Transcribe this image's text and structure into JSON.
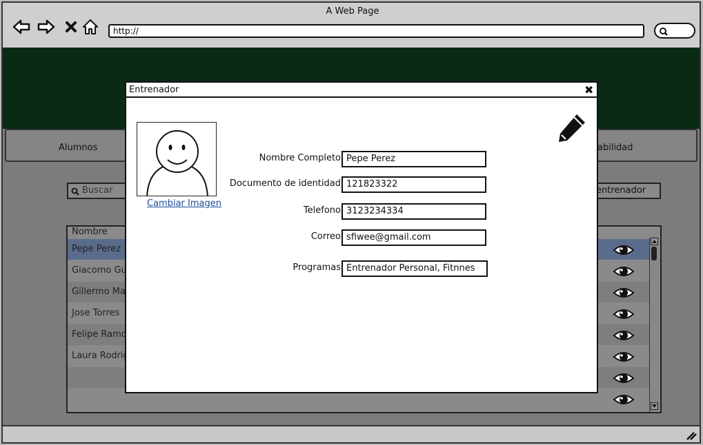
{
  "window": {
    "title": "A Web Page",
    "url": "http://"
  },
  "tabs": [
    {
      "label": "Alumnos"
    },
    {
      "label": "abilidad"
    }
  ],
  "toolbar": {
    "search_placeholder": "Buscar",
    "add_label": "entrenador"
  },
  "table": {
    "column_header": "Nombre",
    "rows": [
      {
        "name": "Pepe Perez",
        "selected": true
      },
      {
        "name": "Giacomo Guili"
      },
      {
        "name": "Gillermo Martı"
      },
      {
        "name": "Jose Torres"
      },
      {
        "name": "Felipe Ramos"
      },
      {
        "name": "Laura Rodrigu"
      },
      {
        "name": ""
      },
      {
        "name": ""
      }
    ]
  },
  "modal": {
    "title": "Entrenador",
    "close_symbol": "✖",
    "change_image_label": "Cambiar Imagen",
    "fields": [
      {
        "label": "Nombre Completo",
        "value": "Pepe Perez"
      },
      {
        "label": "Documento de identidad",
        "value": "121823322"
      },
      {
        "label": "Telefono",
        "value": "3123234334"
      },
      {
        "label": "Correo",
        "value": "sfiwee@gmail.com"
      },
      {
        "label": "Programas",
        "value": "Entrenador Personal, Fitnnes"
      }
    ]
  },
  "colors": {
    "banner": "#0a2a15",
    "selected_row": "#5a6c8c",
    "link": "#1a4a9a"
  },
  "icons": [
    "back-arrow-icon",
    "forward-arrow-icon",
    "close-x-icon",
    "home-icon",
    "search-icon",
    "eye-icon",
    "pencil-icon",
    "resize-grip-icon"
  ]
}
